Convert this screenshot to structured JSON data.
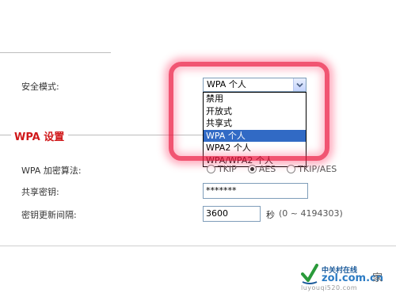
{
  "security_mode": {
    "label": "安全模式:",
    "selected": "WPA 个人",
    "options": [
      "禁用",
      "开放式",
      "共享式",
      "WPA 个人",
      "WPA2 个人",
      "WPA/WPA2 个人"
    ],
    "selected_index": 3
  },
  "wpa_section": {
    "title": "WPA 设置",
    "encryption": {
      "label": "WPA 加密算法:",
      "options": [
        "TKIP",
        "AES",
        "TKIP/AES"
      ],
      "selected": "AES"
    },
    "shared_key": {
      "label": "共享密钥:",
      "value": "*******"
    },
    "rekey_interval": {
      "label": "密钥更新间隔:",
      "value": "3600",
      "unit": "秒",
      "range": "(0 ~ 4194303)"
    }
  },
  "watermark": {
    "line1": "中关村在线",
    "line2": "zol.com.cn",
    "suffix": "家",
    "url": "luyouqi520.com"
  },
  "colors": {
    "section_title": "#d0181a",
    "highlight": "#eb143c",
    "selected_option_bg": "#316ac5"
  }
}
